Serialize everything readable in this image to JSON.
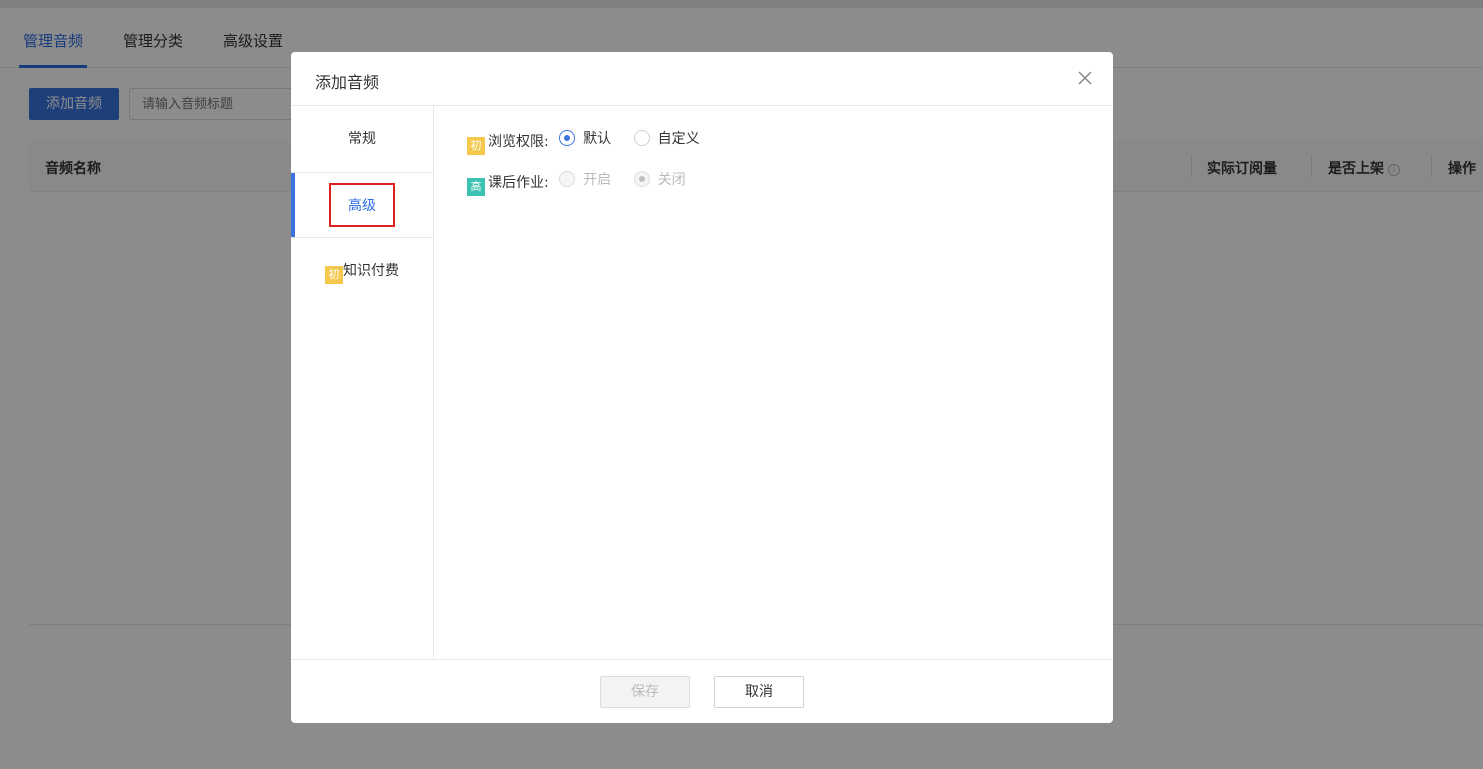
{
  "page": {
    "tabs": [
      {
        "label": "管理音频",
        "active": true
      },
      {
        "label": "管理分类",
        "active": false
      },
      {
        "label": "高级设置",
        "active": false
      }
    ],
    "add_button": "添加音频",
    "search_placeholder": "请输入音频标题",
    "table_headers": {
      "name": "音频名称",
      "subscriptions": "实际订阅量",
      "listed": "是否上架",
      "actions": "操作"
    },
    "info_icon": "i"
  },
  "modal": {
    "title": "添加音频",
    "close_icon": "close-icon",
    "sidebar": [
      {
        "label": "常规",
        "active": false,
        "badge": ""
      },
      {
        "label": "高级",
        "active": true,
        "badge": ""
      },
      {
        "label": "知识付费",
        "active": false,
        "badge": "初"
      }
    ],
    "fields": [
      {
        "badge": "初",
        "badge_color": "#f3c84b",
        "label": "浏览权限:",
        "options": [
          {
            "label": "默认",
            "checked": true,
            "disabled": false
          },
          {
            "label": "自定义",
            "checked": false,
            "disabled": false
          }
        ]
      },
      {
        "badge": "高",
        "badge_color": "#3cc2b2",
        "label": "课后作业:",
        "options": [
          {
            "label": "开启",
            "checked": false,
            "disabled": true
          },
          {
            "label": "关闭",
            "checked": true,
            "disabled": true
          }
        ]
      }
    ],
    "save_label": "保存",
    "cancel_label": "取消"
  },
  "colors": {
    "accent": "#3a73e0",
    "highlight_box": "#e02020",
    "badge_beginner": "#f3c84b",
    "badge_advanced": "#3cc2b2"
  }
}
